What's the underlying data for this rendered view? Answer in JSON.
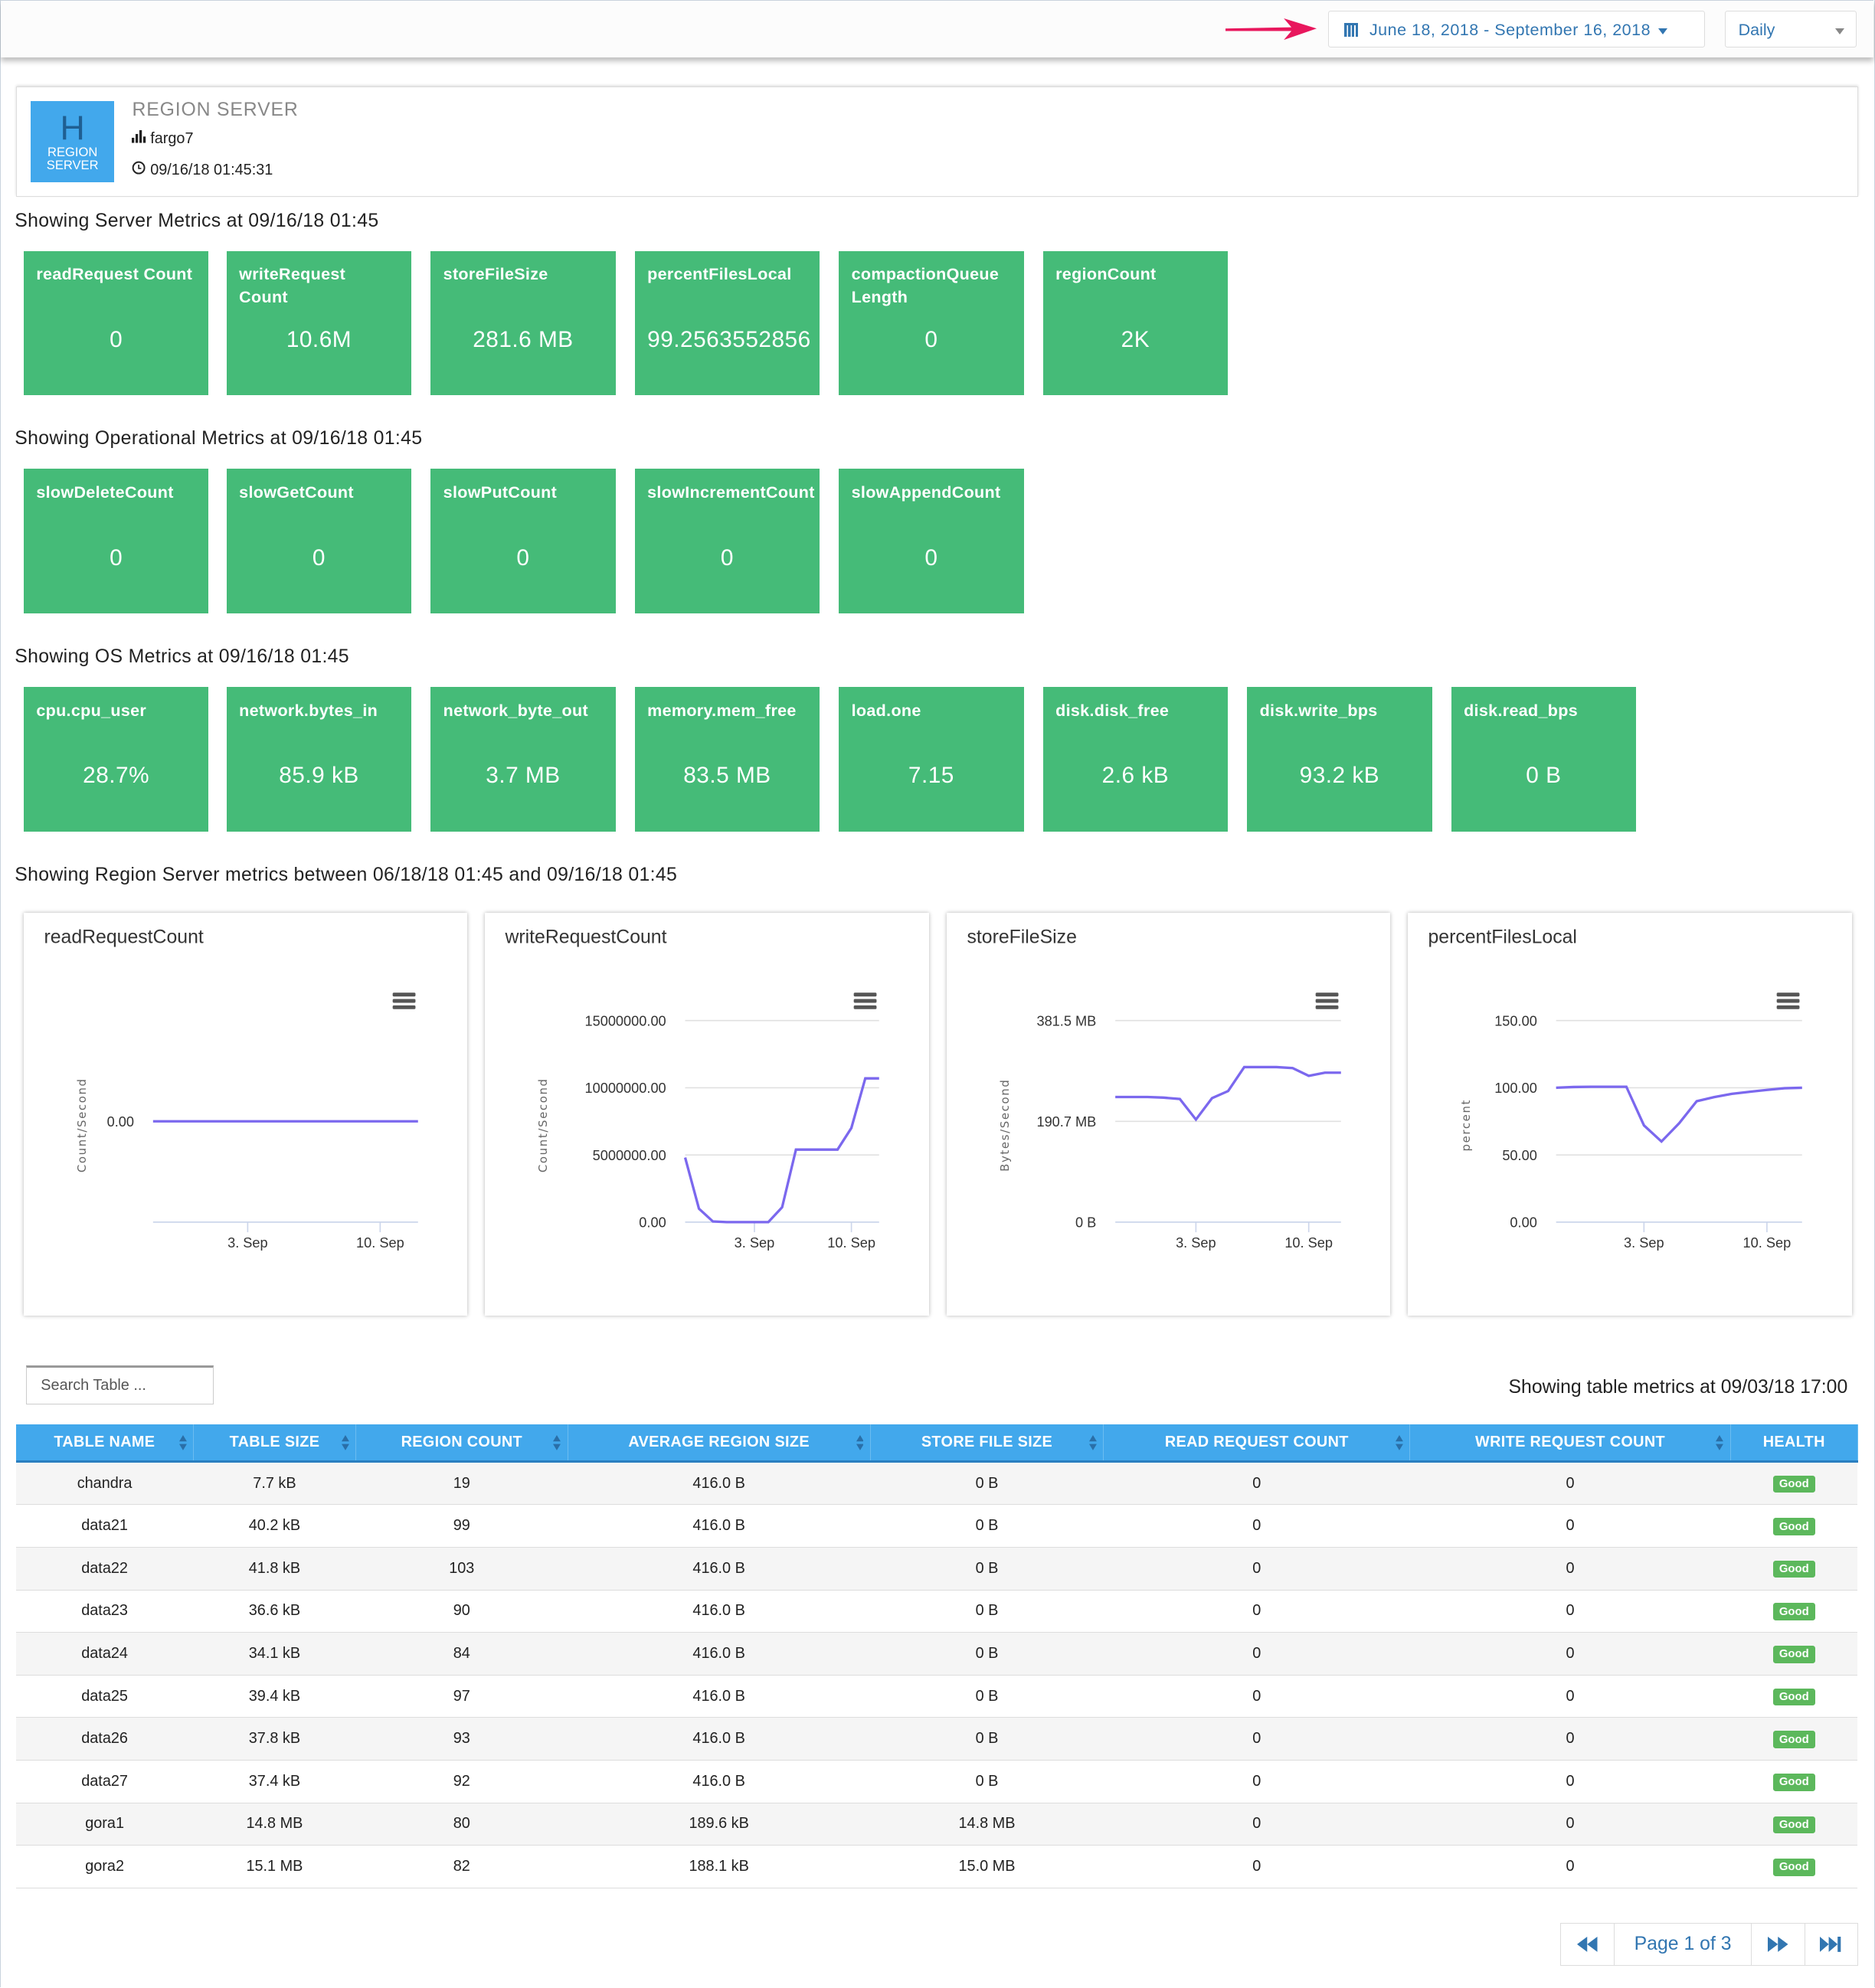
{
  "topbar": {
    "date_range": "June 18, 2018 - September 16, 2018",
    "interval": "Daily",
    "icons": {
      "calendar": "calendar-icon",
      "arrow": "arrow-right-icon"
    },
    "arrow_color": "#e8175d"
  },
  "header": {
    "logo_letter": "H",
    "logo_line1": "REGION",
    "logo_line2": "SERVER",
    "title": "REGION SERVER",
    "host": "fargo7",
    "timestamp": "09/16/18 01:45:31"
  },
  "colors": {
    "tile": "#45bb78",
    "table_header": "#42a8ec",
    "line": "#7b68ee",
    "link": "#3276b1",
    "good": "#5cb85c"
  },
  "sections": {
    "server": {
      "title": "Showing Server Metrics at 09/16/18 01:45",
      "tiles": [
        {
          "label": "readRequest Count",
          "value": "0"
        },
        {
          "label": "writeRequest Count",
          "value": "10.6M"
        },
        {
          "label": "storeFileSize",
          "value": "281.6 MB"
        },
        {
          "label": "percentFilesLocal",
          "value": "99.2563552856"
        },
        {
          "label": "compactionQueue Length",
          "value": "0"
        },
        {
          "label": "regionCount",
          "value": "2K"
        }
      ]
    },
    "operational": {
      "title": "Showing Operational Metrics at 09/16/18 01:45",
      "tiles": [
        {
          "label": "slowDeleteCount",
          "value": "0"
        },
        {
          "label": "slowGetCount",
          "value": "0"
        },
        {
          "label": "slowPutCount",
          "value": "0"
        },
        {
          "label": "slowIncrementCount",
          "value": "0"
        },
        {
          "label": "slowAppendCount",
          "value": "0"
        }
      ]
    },
    "os": {
      "title": "Showing OS Metrics at 09/16/18 01:45",
      "tiles": [
        {
          "label": "cpu.cpu_user",
          "value": "28.7%"
        },
        {
          "label": "network.bytes_in",
          "value": "85.9 kB"
        },
        {
          "label": "network_byte_out",
          "value": "3.7 MB"
        },
        {
          "label": "memory.mem_free",
          "value": "83.5 MB"
        },
        {
          "label": "load.one",
          "value": "7.15"
        },
        {
          "label": "disk.disk_free",
          "value": "2.6 kB"
        },
        {
          "label": "disk.write_bps",
          "value": "93.2 kB"
        },
        {
          "label": "disk.read_bps",
          "value": "0 B"
        }
      ]
    },
    "charts_title": "Showing Region Server metrics between 06/18/18 01:45 and 09/16/18 01:45"
  },
  "chart_data": [
    {
      "type": "line",
      "title": "readRequestCount",
      "ylabel": "Count/Second",
      "x": [
        "2018-08-29",
        "2018-08-30",
        "2018-08-31",
        "2018-09-01",
        "2018-09-02",
        "2018-09-03",
        "2018-09-04",
        "2018-09-05",
        "2018-09-06",
        "2018-09-07",
        "2018-09-08",
        "2018-09-09",
        "2018-09-10",
        "2018-09-11",
        "2018-09-12"
      ],
      "values": [
        0,
        0,
        0,
        0,
        0,
        0,
        0,
        0,
        0,
        0,
        0,
        0,
        0,
        0,
        0
      ],
      "yticks": [
        0
      ],
      "ytick_labels": [
        "0.00"
      ],
      "xticks": [
        "2018-09-03",
        "2018-09-10"
      ],
      "xtick_labels": [
        "3. Sep",
        "10. Sep"
      ],
      "grid": true
    },
    {
      "type": "line",
      "title": "writeRequestCount",
      "ylabel": "Count/Second",
      "x": [
        "2018-08-29",
        "2018-08-30",
        "2018-08-31",
        "2018-09-01",
        "2018-09-02",
        "2018-09-03",
        "2018-09-04",
        "2018-09-05",
        "2018-09-06",
        "2018-09-07",
        "2018-09-08",
        "2018-09-09",
        "2018-09-10",
        "2018-09-11",
        "2018-09-12"
      ],
      "values": [
        4800000,
        1000000,
        50000,
        0,
        0,
        0,
        0,
        1100000,
        5400000,
        5400000,
        5400000,
        5400000,
        7000000,
        10700000,
        10700000
      ],
      "ylim": [
        0,
        15000000
      ],
      "yticks": [
        0,
        5000000,
        10000000,
        15000000
      ],
      "ytick_labels": [
        "0.00",
        "5000000.00",
        "10000000.00",
        "15000000.00"
      ],
      "xticks": [
        "2018-09-03",
        "2018-09-10"
      ],
      "xtick_labels": [
        "3. Sep",
        "10. Sep"
      ],
      "grid": true
    },
    {
      "type": "line",
      "title": "storeFileSize",
      "ylabel": "Bytes/Second",
      "x": [
        "2018-08-29",
        "2018-08-30",
        "2018-08-31",
        "2018-09-01",
        "2018-09-02",
        "2018-09-03",
        "2018-09-04",
        "2018-09-05",
        "2018-09-06",
        "2018-09-07",
        "2018-09-08",
        "2018-09-09",
        "2018-09-10",
        "2018-09-11",
        "2018-09-12"
      ],
      "values": [
        236.7,
        236.7,
        236.7,
        235.7,
        233,
        194,
        234.6,
        248,
        293.5,
        293.5,
        293.5,
        291.5,
        277,
        283,
        283
      ],
      "unit": "MB",
      "ylim": [
        0,
        381.5
      ],
      "yticks": [
        0,
        190.7,
        381.5
      ],
      "ytick_labels": [
        "0 B",
        "190.7 MB",
        "381.5 MB"
      ],
      "xticks": [
        "2018-09-03",
        "2018-09-10"
      ],
      "xtick_labels": [
        "3. Sep",
        "10. Sep"
      ],
      "grid": true
    },
    {
      "type": "line",
      "title": "percentFilesLocal",
      "ylabel": "percent",
      "x": [
        "2018-08-29",
        "2018-08-30",
        "2018-08-31",
        "2018-09-01",
        "2018-09-02",
        "2018-09-03",
        "2018-09-04",
        "2018-09-05",
        "2018-09-06",
        "2018-09-07",
        "2018-09-08",
        "2018-09-09",
        "2018-09-10",
        "2018-09-11",
        "2018-09-12"
      ],
      "values": [
        100,
        100.6,
        100.8,
        100.8,
        100.8,
        72,
        60,
        73.5,
        90,
        93,
        95.5,
        97,
        98.4,
        99.6,
        100
      ],
      "ylim": [
        0,
        150
      ],
      "yticks": [
        0,
        50,
        100,
        150
      ],
      "ytick_labels": [
        "0.00",
        "50.00",
        "100.00",
        "150.00"
      ],
      "xticks": [
        "2018-09-03",
        "2018-09-10"
      ],
      "xtick_labels": [
        "3. Sep",
        "10. Sep"
      ],
      "grid": true
    }
  ],
  "table": {
    "search_placeholder": "Search Table ...",
    "caption": "Showing table metrics at 09/03/18 17:00",
    "columns": [
      "TABLE NAME",
      "TABLE SIZE",
      "REGION COUNT",
      "AVERAGE REGION SIZE",
      "STORE FILE SIZE",
      "READ REQUEST COUNT",
      "WRITE REQUEST COUNT",
      "HEALTH"
    ],
    "rows": [
      [
        "chandra",
        "7.7 kB",
        "19",
        "416.0 B",
        "0 B",
        "0",
        "0",
        "Good"
      ],
      [
        "data21",
        "40.2 kB",
        "99",
        "416.0 B",
        "0 B",
        "0",
        "0",
        "Good"
      ],
      [
        "data22",
        "41.8 kB",
        "103",
        "416.0 B",
        "0 B",
        "0",
        "0",
        "Good"
      ],
      [
        "data23",
        "36.6 kB",
        "90",
        "416.0 B",
        "0 B",
        "0",
        "0",
        "Good"
      ],
      [
        "data24",
        "34.1 kB",
        "84",
        "416.0 B",
        "0 B",
        "0",
        "0",
        "Good"
      ],
      [
        "data25",
        "39.4 kB",
        "97",
        "416.0 B",
        "0 B",
        "0",
        "0",
        "Good"
      ],
      [
        "data26",
        "37.8 kB",
        "93",
        "416.0 B",
        "0 B",
        "0",
        "0",
        "Good"
      ],
      [
        "data27",
        "37.4 kB",
        "92",
        "416.0 B",
        "0 B",
        "0",
        "0",
        "Good"
      ],
      [
        "gora1",
        "14.8 MB",
        "80",
        "189.6 kB",
        "14.8 MB",
        "0",
        "0",
        "Good"
      ],
      [
        "gora2",
        "15.1 MB",
        "82",
        "188.1 kB",
        "15.0 MB",
        "0",
        "0",
        "Good"
      ]
    ]
  },
  "pagination": {
    "label": "Page 1 of 3",
    "current": 1,
    "total": 3
  }
}
